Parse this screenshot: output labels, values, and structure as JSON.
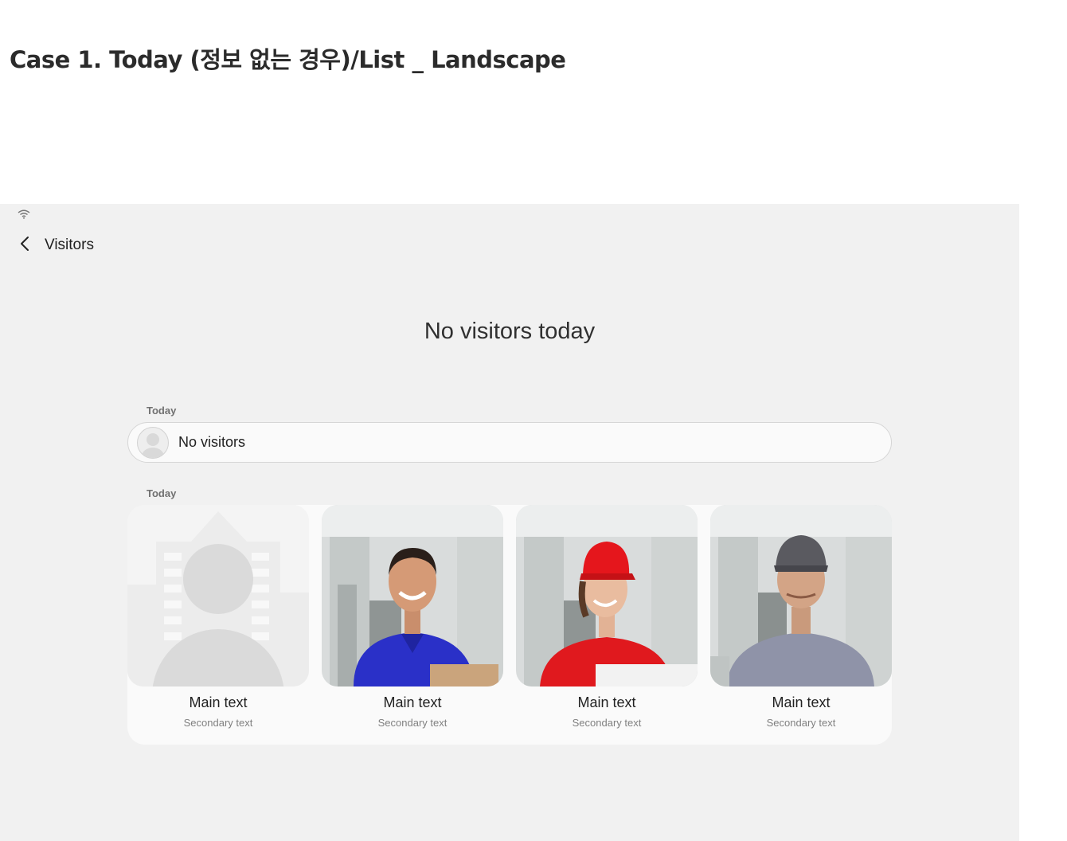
{
  "doc": {
    "title": "Case 1. Today (정보 없는 경우)/List _ Landscape"
  },
  "status_bar": {
    "wifi_icon": "wifi-icon"
  },
  "app_bar": {
    "back_icon": "chevron-left-icon",
    "title": "Visitors"
  },
  "empty_state": {
    "heading": "No visitors today"
  },
  "section_one": {
    "label": "Today",
    "row": {
      "avatar_icon": "default-avatar-icon",
      "label": "No visitors"
    }
  },
  "section_two": {
    "label": "Today",
    "cards": [
      {
        "photo": "placeholder-person-icon",
        "main": "Main text",
        "secondary": "Secondary text"
      },
      {
        "photo": "delivery-man-blue-shirt",
        "main": "Main text",
        "secondary": "Secondary text"
      },
      {
        "photo": "delivery-woman-red-cap",
        "main": "Main text",
        "secondary": "Secondary text"
      },
      {
        "photo": "man-gray-cap",
        "main": "Main text",
        "secondary": "Secondary text"
      }
    ]
  },
  "colors": {
    "screen_bg": "#f1f1f1",
    "panel_bg": "#fafafa",
    "placeholder_gray": "#dadada"
  }
}
